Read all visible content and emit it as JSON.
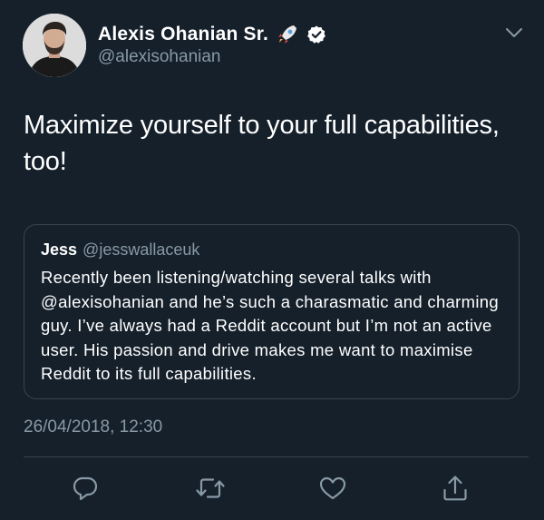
{
  "tweet": {
    "author": {
      "name": "Alexis Ohanian Sr.",
      "handle": "@alexisohanian",
      "badge_emoji_icon": "rocket-icon",
      "verified_icon": "verified-badge-icon"
    },
    "text": "Maximize yourself to your full capabilities, too!",
    "timestamp": "26/04/2018, 12:30",
    "quoted": {
      "name": "Jess",
      "handle": "@jesswallaceuk",
      "text": "Recently been listening/watching several talks with @alexisohanian and he’s such a charasmatic and charming guy. I’ve always had a Reddit account but I’m not an active user. His passion and drive makes me want to maximise Reddit to its full capabilities."
    },
    "actions": [
      "reply-icon",
      "retweet-icon",
      "like-icon",
      "share-icon"
    ],
    "menu_icon": "chevron-down-icon"
  },
  "colors": {
    "background": "#15202b",
    "text": "#ffffff",
    "secondary": "#8899a6",
    "border": "#38444d"
  }
}
